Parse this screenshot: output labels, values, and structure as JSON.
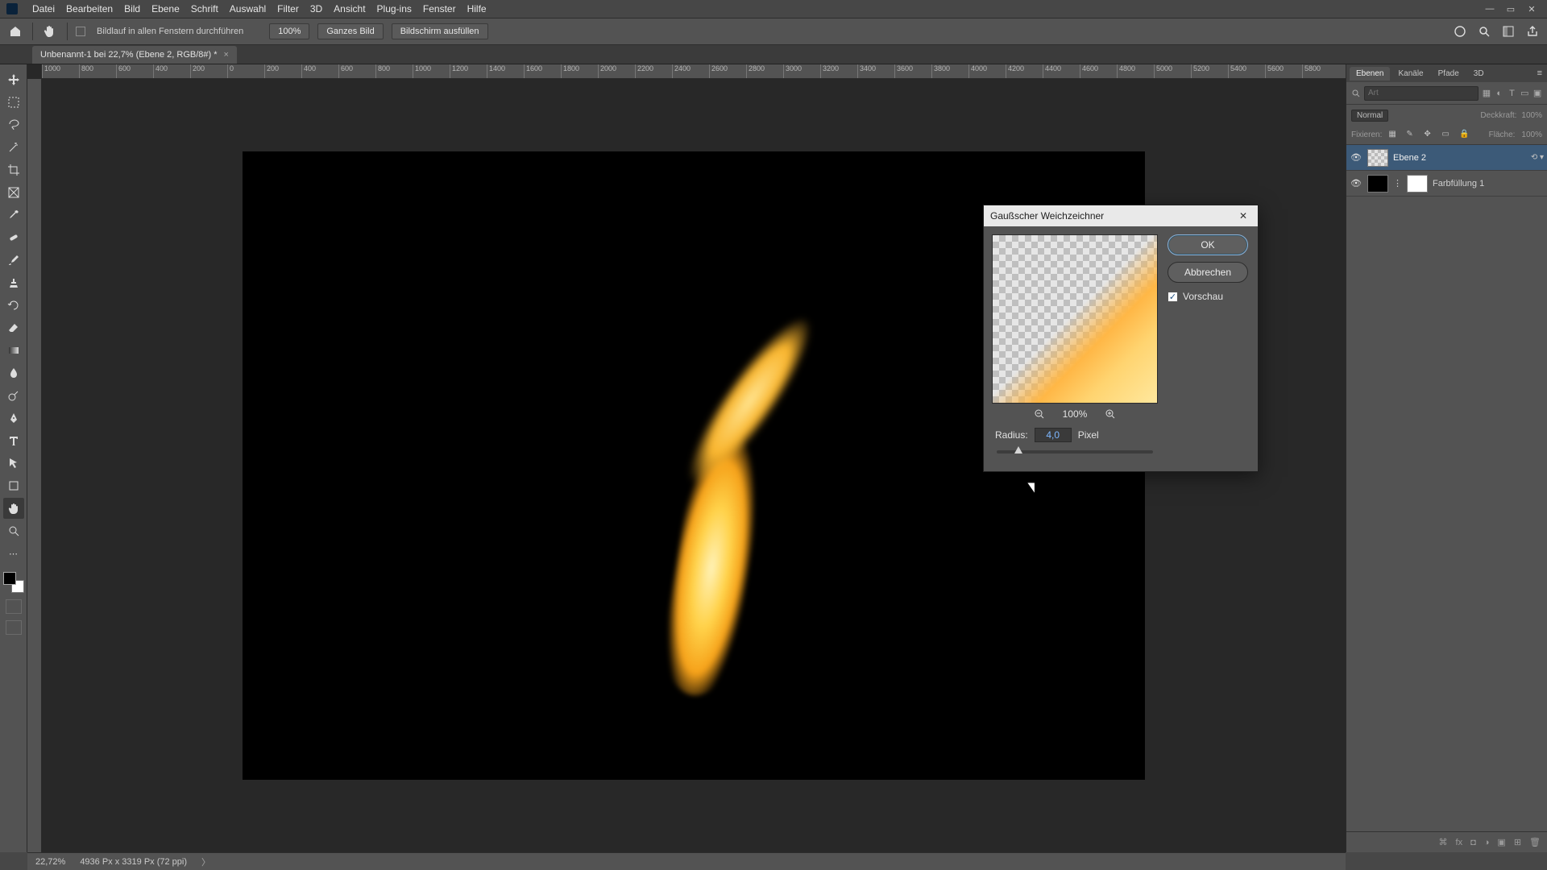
{
  "menu": {
    "items": [
      "Datei",
      "Bearbeiten",
      "Bild",
      "Ebene",
      "Schrift",
      "Auswahl",
      "Filter",
      "3D",
      "Ansicht",
      "Plug-ins",
      "Fenster",
      "Hilfe"
    ]
  },
  "optbar": {
    "scroll_all_label": "Bildlauf in allen Fenstern durchführen",
    "zoom": "100%",
    "fit_image": "Ganzes Bild",
    "fill_screen": "Bildschirm ausfüllen"
  },
  "doc_tab": {
    "title": "Unbenannt-1 bei 22,7% (Ebene 2, RGB/8#) *"
  },
  "ruler_values": [
    "1000",
    "800",
    "600",
    "400",
    "200",
    "0",
    "200",
    "400",
    "600",
    "800",
    "1000",
    "1200",
    "1400",
    "1600",
    "1800",
    "2000",
    "2200",
    "2400",
    "2600",
    "2800",
    "3000",
    "3200",
    "3400",
    "3600",
    "3800",
    "4000",
    "4200",
    "4400",
    "4600",
    "4800",
    "5000",
    "5200",
    "5400",
    "5600",
    "5800"
  ],
  "panels": {
    "tabs": [
      "Ebenen",
      "Kanäle",
      "Pfade",
      "3D"
    ],
    "search_placeholder": "Art",
    "blend_mode": "Normal",
    "opacity_label": "Deckkraft:",
    "opacity_value": "100%",
    "lock_label": "Fixieren:",
    "fill_label": "Fläche:",
    "fill_value": "100%",
    "layers": [
      {
        "name": "Ebene 2",
        "selected": true,
        "link": true
      },
      {
        "name": "Farbfüllung 1",
        "selected": false,
        "mask": true
      }
    ]
  },
  "dialog": {
    "title": "Gaußscher Weichzeichner",
    "ok": "OK",
    "cancel": "Abbrechen",
    "preview_label": "Vorschau",
    "zoom": "100%",
    "radius_label": "Radius:",
    "radius_value": "4,0",
    "radius_unit": "Pixel"
  },
  "status": {
    "zoom": "22,72%",
    "doc_info": "4936 Px x 3319 Px (72 ppi)"
  }
}
